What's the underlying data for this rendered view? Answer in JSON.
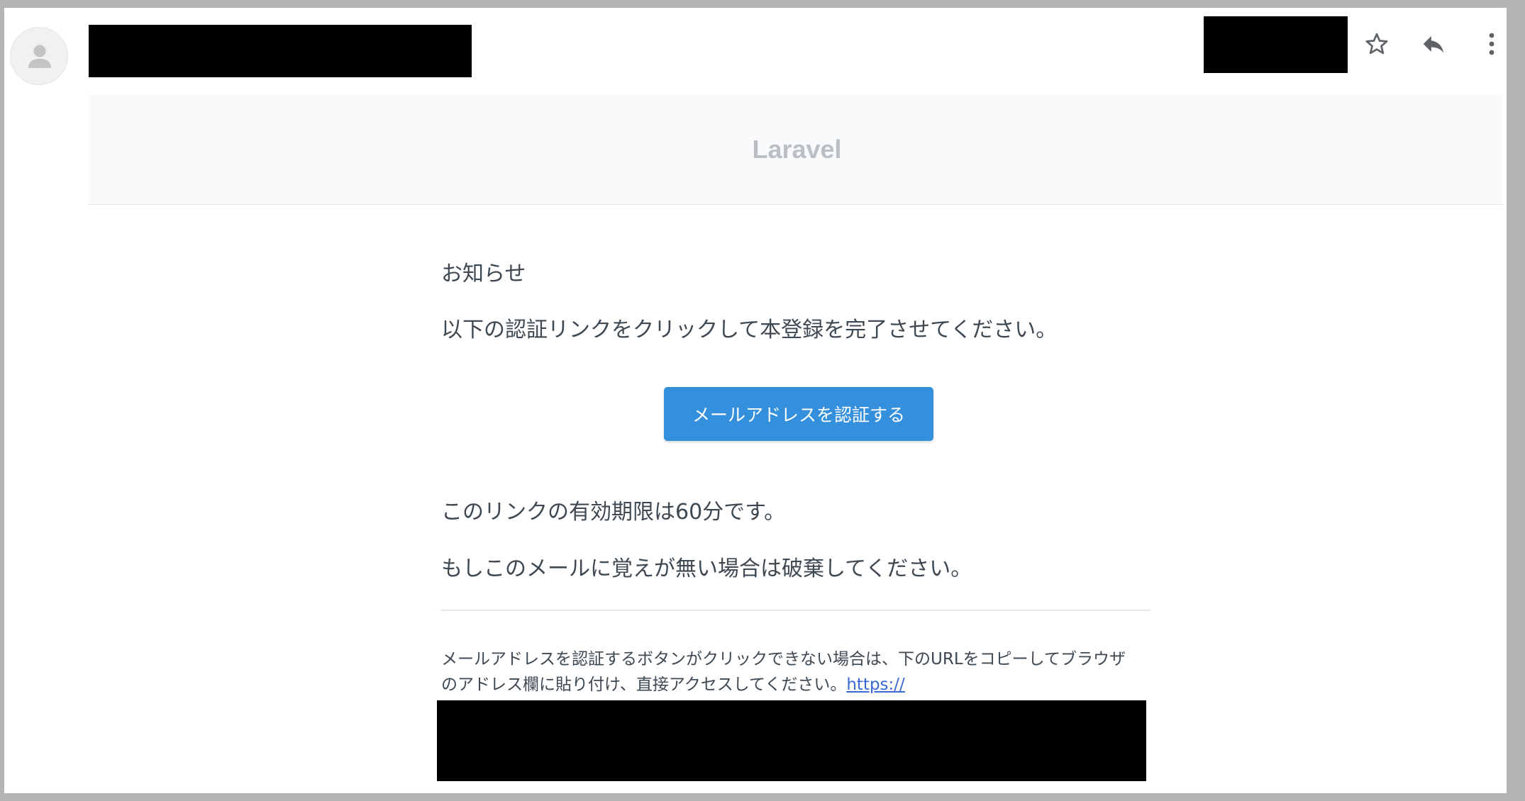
{
  "header": {
    "icons": {
      "avatar": "person-icon",
      "star": "star-icon",
      "reply": "reply-icon",
      "more": "more-vert-icon"
    }
  },
  "email": {
    "brand": "Laravel",
    "greeting": "お知らせ",
    "intro": "以下の認証リンクをクリックして本登録を完了させてください。",
    "action_label": "メールアドレスを認証する",
    "expiry_note": "このリンクの有効期限は60分です。",
    "ignore_note": "もしこのメールに覚えが無い場合は破棄してください。",
    "subcopy_line1": "メールアドレスを認証するボタンがクリックできない場合は、下のURLをコピーしてブラウザ",
    "subcopy_line2": "のアドレス欄に貼り付け、直接アクセスしてください。",
    "subcopy_link": "https://"
  },
  "colors": {
    "button": "#3490dc",
    "link": "#3869d4",
    "brand_text": "#bbbfc3",
    "header_bg": "#f8fafc",
    "body_text": "#3d4852"
  }
}
